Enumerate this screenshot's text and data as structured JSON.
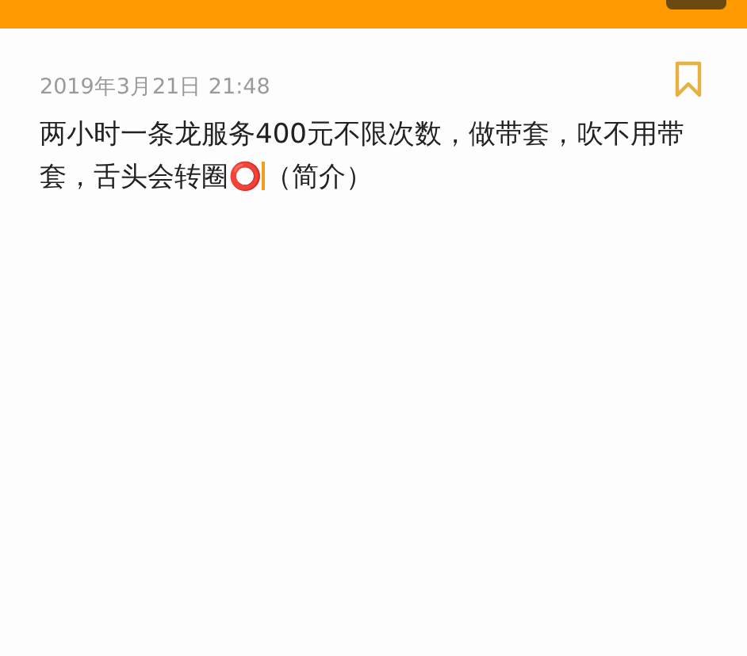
{
  "note": {
    "date": "2019年3月21日 21:48",
    "body": "两小时一条龙服务400元不限次数，做带套，吹不用带套，舌头会转圈⭕",
    "suffix": "（简介）"
  }
}
